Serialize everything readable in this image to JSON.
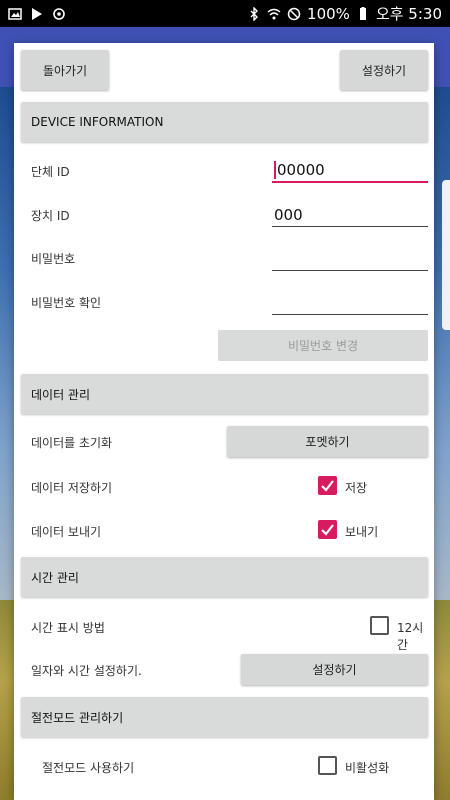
{
  "status_bar": {
    "battery": "100%",
    "time": "오후 5:30"
  },
  "header": {
    "back_label": "돌아가기",
    "settings_label": "설정하기"
  },
  "device_info": {
    "section_title": "DEVICE INFORMATION",
    "org_id_label": "단체 ID",
    "org_id_value": "00000",
    "device_id_label": "장치 ID",
    "device_id_value": "000",
    "password_label": "비밀번호",
    "password_value": "",
    "password_confirm_label": "비밀번호 확인",
    "password_confirm_value": "",
    "change_password_label": "비밀번호 변경"
  },
  "data_mgmt": {
    "section_title": "데이터 관리",
    "reset_label": "데이터를 초기화",
    "format_button": "포멧하기",
    "save_label": "데이터 저장하기",
    "save_checkbox_label": "저장",
    "save_checked": true,
    "send_label": "데이터 보내기",
    "send_checkbox_label": "보내기",
    "send_checked": true
  },
  "time_mgmt": {
    "section_title": "시간 관리",
    "display_label": "시간 표시 방법",
    "hour12_label": "12시간",
    "hour12_checked": false,
    "datetime_label": "일자와 시간 설정하기.",
    "datetime_button": "설정하기"
  },
  "power_mgmt": {
    "section_title": "절전모드 관리하기",
    "use_label": "절전모드 사용하기",
    "disable_label": "비활성화",
    "disable_checked": false
  }
}
